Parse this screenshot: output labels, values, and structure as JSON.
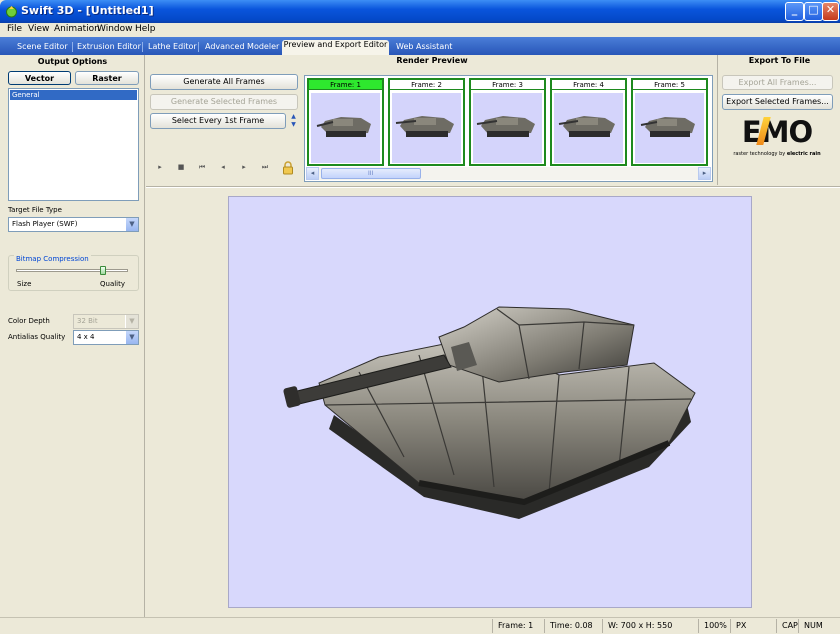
{
  "window": {
    "title": "Swift 3D - [Untitled1]"
  },
  "menu": [
    "File",
    "View",
    "Animation",
    "Window",
    "Help"
  ],
  "tabs": [
    "Scene Editor",
    "Extrusion Editor",
    "Lathe Editor",
    "Advanced Modeler",
    "Preview and Export Editor",
    "Web Assistant"
  ],
  "output_options": {
    "title": "Output Options",
    "vector_label": "Vector",
    "raster_label": "Raster",
    "list_items": [
      "General"
    ],
    "target_file_type_label": "Target File Type",
    "target_file_type_value": "Flash Player (SWF)",
    "bitmap_compression_label": "Bitmap Compression",
    "slider_min_label": "Size",
    "slider_max_label": "Quality",
    "slider_value": 0.8,
    "color_depth_label": "Color Depth",
    "color_depth_value": "32 Bit",
    "antialias_label": "Antialias Quality",
    "antialias_value": "4 x 4"
  },
  "render_preview": {
    "title": "Render Preview",
    "generate_all_label": "Generate All Frames",
    "generate_selected_label": "Generate Selected Frames",
    "select_every_label": "Select Every 1st Frame",
    "frames": [
      "Frame: 1",
      "Frame: 2",
      "Frame: 3",
      "Frame: 4",
      "Frame: 5"
    ],
    "scroll_thumb_glyph": "III"
  },
  "export": {
    "title": "Export To File",
    "export_all_label": "Export All Frames...",
    "export_selected_label": "Export Selected Frames...",
    "logo_text": "EMO",
    "logo_caption": "raster technology",
    "logo_by": "by",
    "logo_brand": "electric rain"
  },
  "status": {
    "frame": "Frame: 1",
    "time": "Time: 0.08",
    "size": "W: 700 x H: 550",
    "zoom": "100%",
    "unit": "PX",
    "caps": "CAP",
    "num": "NUM"
  },
  "colors": {
    "accent": "#0a55dc",
    "stage_bg": "#d8d8fc",
    "frame_border": "#1e8a1e",
    "frame_selected": "#2ee82e"
  }
}
